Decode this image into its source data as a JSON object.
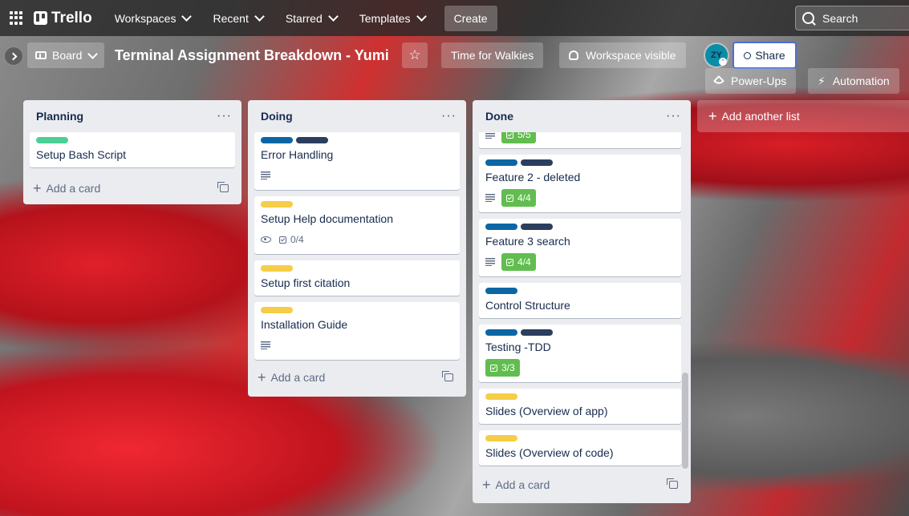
{
  "topnav": {
    "logo": "Trello",
    "menus": [
      "Workspaces",
      "Recent",
      "Starred",
      "Templates"
    ],
    "create": "Create",
    "search": "Search"
  },
  "board": {
    "view": "Board",
    "title": "Terminal Assignment Breakdown - Yumi",
    "walkies": "Time for Walkies",
    "visibility": "Workspace visible",
    "avatar": "ZY",
    "share": "Share",
    "powerups": "Power-Ups",
    "automation": "Automation"
  },
  "colors": {
    "green": "#4bce97",
    "blue": "#0c66a4",
    "navy": "#2c3e5d",
    "yellow": "#f5cd47"
  },
  "lists": [
    {
      "title": "Planning",
      "add_card": "Add a card",
      "cards": [
        {
          "title": "Setup Bash Script",
          "labels": [
            "green"
          ]
        }
      ]
    },
    {
      "title": "Doing",
      "add_card": "Add a card",
      "cards": [
        {
          "title": "Error Handling",
          "labels": [
            "blue",
            "navy"
          ],
          "description": true
        },
        {
          "title": "Setup Help documentation",
          "labels": [
            "yellow"
          ],
          "watching": true,
          "checklist": "0/4",
          "complete": false
        },
        {
          "title": "Setup first citation",
          "labels": [
            "yellow"
          ]
        },
        {
          "title": "Installation Guide",
          "labels": [
            "yellow"
          ],
          "description": true
        }
      ]
    },
    {
      "title": "Done",
      "add_card": "Add a card",
      "cards": [
        {
          "title": "",
          "checklist": "5/5",
          "complete": true,
          "clipped": true
        },
        {
          "title": "Feature 2 - deleted",
          "labels": [
            "blue",
            "navy"
          ],
          "description": true,
          "checklist": "4/4",
          "complete": true
        },
        {
          "title": "Feature 3 search",
          "labels": [
            "blue",
            "navy"
          ],
          "description": true,
          "checklist": "4/4",
          "complete": true
        },
        {
          "title": "Control Structure",
          "labels": [
            "blue"
          ]
        },
        {
          "title": "Testing -TDD",
          "labels": [
            "blue",
            "navy"
          ],
          "checklist": "3/3",
          "complete": true
        },
        {
          "title": "Slides (Overview of app)",
          "labels": [
            "yellow"
          ]
        },
        {
          "title": "Slides (Overview of code)",
          "labels": [
            "yellow"
          ]
        }
      ]
    }
  ],
  "add_list": "Add another list"
}
